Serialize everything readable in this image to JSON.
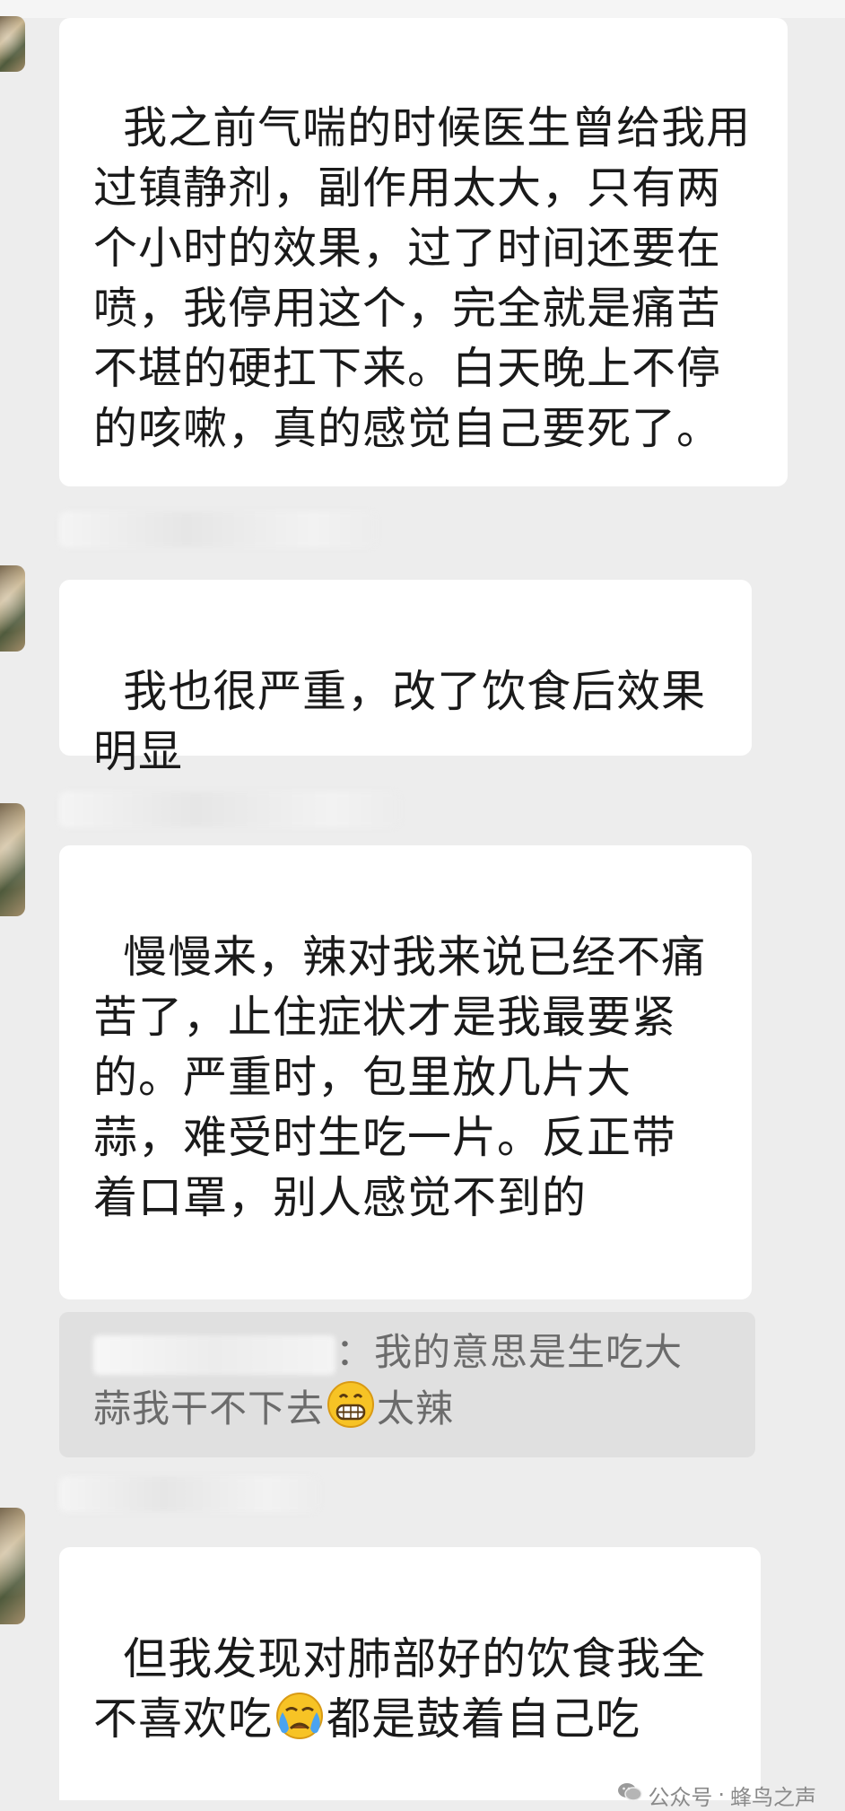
{
  "messages": [
    {
      "text": "我之前气喘的时候医生曾给我用过镇静剂，副作用太大，只有两个小时的效果，过了时间还要在喷，我停用这个，完全就是痛苦不堪的硬扛下来。白天晚上不停的咳嗽，真的感觉自己要死了。"
    },
    {
      "text": "我也很严重，改了饮食后效果明显"
    },
    {
      "text": "慢慢来，辣对我来说已经不痛苦了，止住症状才是我最要紧的。严重时，包里放几片大蒜，难受时生吃一片。反正带着口罩，别人感觉不到的"
    },
    {
      "quote": {
        "colon": "：",
        "part1": "我的意思是生吃大",
        "part2": "蒜我干不下去",
        "emoji": "grin-emoji",
        "part3": "太辣"
      }
    },
    {
      "part1": "但我发现对肺部好的饮食我全不喜欢吃",
      "emoji": "crying-face-emoji",
      "part2": "都是鼓着自己吃"
    }
  ],
  "footer": {
    "label": "公众号",
    "separator": "·",
    "account": "蜂鸟之声",
    "icon": "wechat-icon",
    "color": "#8a8a8a"
  },
  "colors": {
    "background": "#ededed",
    "bubble": "#ffffff",
    "quote": "#e0e0e0"
  }
}
